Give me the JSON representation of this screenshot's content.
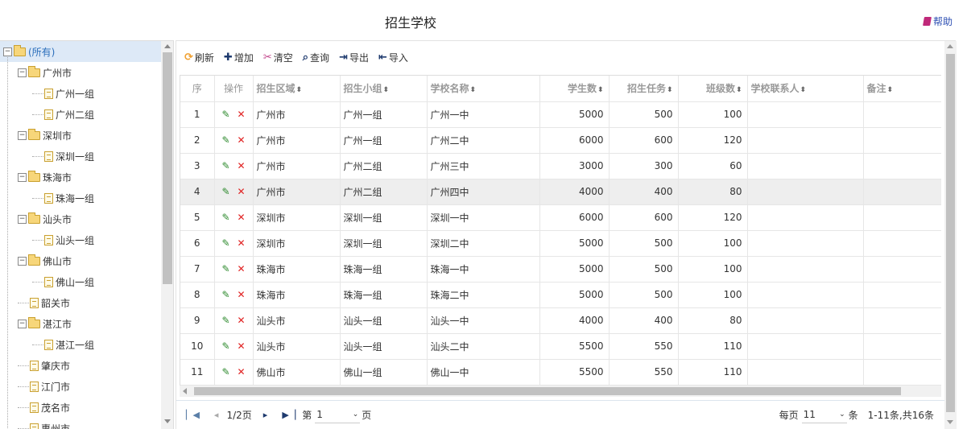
{
  "header": {
    "title": "招生学校",
    "help_label": "帮助"
  },
  "tree": {
    "items": [
      {
        "label": "(所有)",
        "type": "folder",
        "level": 0,
        "selected": true
      },
      {
        "label": "广州市",
        "type": "folder",
        "level": 1
      },
      {
        "label": "广州一组",
        "type": "file",
        "level": 2
      },
      {
        "label": "广州二组",
        "type": "file",
        "level": 2
      },
      {
        "label": "深圳市",
        "type": "folder",
        "level": 1
      },
      {
        "label": "深圳一组",
        "type": "file",
        "level": 2
      },
      {
        "label": "珠海市",
        "type": "folder",
        "level": 1
      },
      {
        "label": "珠海一组",
        "type": "file",
        "level": 2
      },
      {
        "label": "汕头市",
        "type": "folder",
        "level": 1
      },
      {
        "label": "汕头一组",
        "type": "file",
        "level": 2
      },
      {
        "label": "佛山市",
        "type": "folder",
        "level": 1
      },
      {
        "label": "佛山一组",
        "type": "file",
        "level": 2
      },
      {
        "label": "韶关市",
        "type": "file",
        "level": 1
      },
      {
        "label": "湛江市",
        "type": "folder",
        "level": 1
      },
      {
        "label": "湛江一组",
        "type": "file",
        "level": 2
      },
      {
        "label": "肇庆市",
        "type": "file",
        "level": 1
      },
      {
        "label": "江门市",
        "type": "file",
        "level": 1
      },
      {
        "label": "茂名市",
        "type": "file",
        "level": 1
      },
      {
        "label": "惠州市",
        "type": "file",
        "level": 1
      }
    ]
  },
  "toolbar": {
    "refresh": "刷新",
    "add": "增加",
    "clear": "清空",
    "query": "查询",
    "export": "导出",
    "import": "导入"
  },
  "table": {
    "headers": {
      "seq": "序",
      "op": "操作",
      "region": "招生区域",
      "group": "招生小组",
      "school": "学校名称",
      "students": "学生数",
      "task": "招生任务",
      "classes": "班级数",
      "contact": "学校联系人",
      "remark": "备注"
    },
    "rows": [
      {
        "seq": "1",
        "region": "广州市",
        "group": "广州一组",
        "school": "广州一中",
        "students": "5000",
        "task": "500",
        "classes": "100",
        "contact": "",
        "remark": ""
      },
      {
        "seq": "2",
        "region": "广州市",
        "group": "广州一组",
        "school": "广州二中",
        "students": "6000",
        "task": "600",
        "classes": "120",
        "contact": "",
        "remark": ""
      },
      {
        "seq": "3",
        "region": "广州市",
        "group": "广州二组",
        "school": "广州三中",
        "students": "3000",
        "task": "300",
        "classes": "60",
        "contact": "",
        "remark": ""
      },
      {
        "seq": "4",
        "region": "广州市",
        "group": "广州二组",
        "school": "广州四中",
        "students": "4000",
        "task": "400",
        "classes": "80",
        "contact": "",
        "remark": "",
        "hover": true
      },
      {
        "seq": "5",
        "region": "深圳市",
        "group": "深圳一组",
        "school": "深圳一中",
        "students": "6000",
        "task": "600",
        "classes": "120",
        "contact": "",
        "remark": ""
      },
      {
        "seq": "6",
        "region": "深圳市",
        "group": "深圳一组",
        "school": "深圳二中",
        "students": "5000",
        "task": "500",
        "classes": "100",
        "contact": "",
        "remark": ""
      },
      {
        "seq": "7",
        "region": "珠海市",
        "group": "珠海一组",
        "school": "珠海一中",
        "students": "5000",
        "task": "500",
        "classes": "100",
        "contact": "",
        "remark": ""
      },
      {
        "seq": "8",
        "region": "珠海市",
        "group": "珠海一组",
        "school": "珠海二中",
        "students": "5000",
        "task": "500",
        "classes": "100",
        "contact": "",
        "remark": ""
      },
      {
        "seq": "9",
        "region": "汕头市",
        "group": "汕头一组",
        "school": "汕头一中",
        "students": "4000",
        "task": "400",
        "classes": "80",
        "contact": "",
        "remark": ""
      },
      {
        "seq": "10",
        "region": "汕头市",
        "group": "汕头一组",
        "school": "汕头二中",
        "students": "5500",
        "task": "550",
        "classes": "110",
        "contact": "",
        "remark": ""
      },
      {
        "seq": "11",
        "region": "佛山市",
        "group": "佛山一组",
        "school": "佛山一中",
        "students": "5500",
        "task": "550",
        "classes": "110",
        "contact": "",
        "remark": ""
      }
    ]
  },
  "pager": {
    "page_info": "1/2页",
    "goto_prefix": "第",
    "current_page": "1",
    "goto_suffix": "页",
    "per_page_prefix": "每页",
    "per_page": "11",
    "per_page_suffix": "条",
    "summary": "1-11条,共16条"
  }
}
